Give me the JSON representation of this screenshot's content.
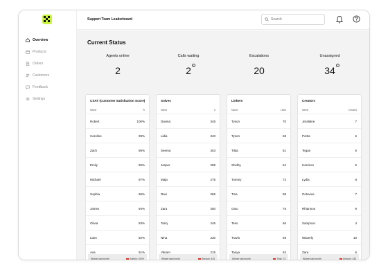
{
  "header": {
    "title": "Support Team Leaderboard",
    "search_placeholder": "Search"
  },
  "sidebar": {
    "items": [
      {
        "label": "Overview",
        "icon": "home-icon",
        "active": true
      },
      {
        "label": "Products",
        "icon": "box-icon",
        "active": false
      },
      {
        "label": "Orders",
        "icon": "clipboard-icon",
        "active": false
      },
      {
        "label": "Customers",
        "icon": "users-icon",
        "active": false
      },
      {
        "label": "Feedback",
        "icon": "chat-icon",
        "active": false
      },
      {
        "label": "Settings",
        "icon": "gear-icon",
        "active": false
      }
    ]
  },
  "main": {
    "section_title": "Current Status",
    "stats": [
      {
        "label": "Agents online",
        "value": "2",
        "info": false
      },
      {
        "label": "Calls waiting",
        "value": "2",
        "info": true
      },
      {
        "label": "Escalations",
        "value": "20",
        "info": false
      },
      {
        "label": "Unassigned",
        "value": "34",
        "info": true
      }
    ],
    "panels": [
      {
        "title": "CSAT (Customer Satisfaction Score)",
        "col_name": "Name",
        "col_value": "%",
        "rows": [
          [
            "Robert",
            "100%"
          ],
          [
            "Caroline",
            "99%"
          ],
          [
            "Zach",
            "95%"
          ],
          [
            "Emily",
            "95%"
          ],
          [
            "Michael",
            "97%"
          ],
          [
            "Sophia",
            "96%"
          ],
          [
            "James",
            "94%"
          ],
          [
            "Olivia",
            "93%"
          ],
          [
            "Liam",
            "92%"
          ],
          [
            "Ava",
            "91%"
          ]
        ],
        "footer_label": "Winner last month",
        "footer_value": "Kathrin: 100%"
      },
      {
        "title": "Solves",
        "col_name": "Name",
        "col_value": "#",
        "rows": [
          [
            "Davina",
            "345"
          ],
          [
            "Lidia",
            "340"
          ],
          [
            "Seema",
            "303"
          ],
          [
            "Jasper",
            "289"
          ],
          [
            "Maja",
            "275"
          ],
          [
            "Ravi",
            "266"
          ],
          [
            "Zara",
            "250"
          ],
          [
            "Tariq",
            "245"
          ],
          [
            "Nina",
            "230"
          ],
          [
            "Vikram",
            "215"
          ]
        ],
        "footer_label": "Winner last month",
        "footer_value": "Gregory: 433"
      },
      {
        "title": "Linkers",
        "col_name": "Name",
        "col_value": "Links",
        "rows": [
          [
            "Tyson",
            "70"
          ],
          [
            "Tyson",
            "68"
          ],
          [
            "Tilda",
            "61"
          ],
          [
            "Shelby",
            "64"
          ],
          [
            "Tommy",
            "72"
          ],
          [
            "Tina",
            "58"
          ],
          [
            "Otso",
            "75"
          ],
          [
            "Tess",
            "66"
          ],
          [
            "Travis",
            "69"
          ],
          [
            "Tanya",
            "63"
          ]
        ],
        "footer_label": "Winner last month",
        "footer_value": "Tilda: 73"
      },
      {
        "title": "Creators",
        "col_name": "Name",
        "col_value": "Created",
        "rows": [
          [
            "Jeraldine",
            "7"
          ],
          [
            "Portia",
            "6"
          ],
          [
            "Tegan",
            "6"
          ],
          [
            "Harrison",
            "5"
          ],
          [
            "Lydia",
            "8"
          ],
          [
            "Octavius",
            "7"
          ],
          [
            "Rhiannon",
            "9"
          ],
          [
            "Sampson",
            "4"
          ],
          [
            "Waverly",
            "10"
          ],
          [
            "Zara",
            "6"
          ]
        ],
        "footer_label": "Winner last month",
        "footer_value": "Gregory: 433"
      }
    ]
  },
  "colors": {
    "accent": "#c9f23a",
    "flag": "#d9352b"
  }
}
